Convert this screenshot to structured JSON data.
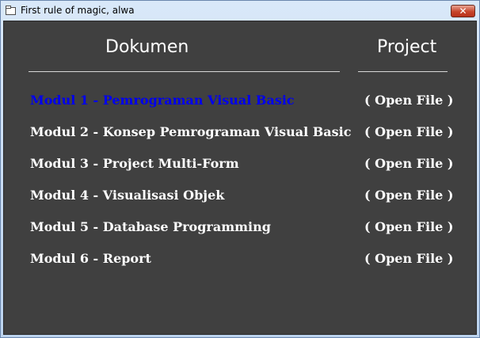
{
  "window": {
    "title": "First rule of magic, alwa",
    "close_glyph": "✕"
  },
  "headers": {
    "documents": "Dokumen",
    "project": "Project"
  },
  "colors": {
    "background": "#404040",
    "text": "#ffffff",
    "active_link": "#0000ee"
  },
  "modules": [
    {
      "label": "Modul 1 - Pemrograman Visual Basic",
      "action": "( Open File )",
      "active": true
    },
    {
      "label": "Modul 2 - Konsep Pemrograman Visual Basic",
      "action": "( Open File )",
      "active": false
    },
    {
      "label": "Modul 3 - Project Multi-Form",
      "action": "( Open File )",
      "active": false
    },
    {
      "label": "Modul 4 - Visualisasi Objek",
      "action": "( Open File )",
      "active": false
    },
    {
      "label": "Modul 5 - Database Programming",
      "action": "( Open File )",
      "active": false
    },
    {
      "label": "Modul 6 - Report",
      "action": "( Open File )",
      "active": false
    }
  ]
}
